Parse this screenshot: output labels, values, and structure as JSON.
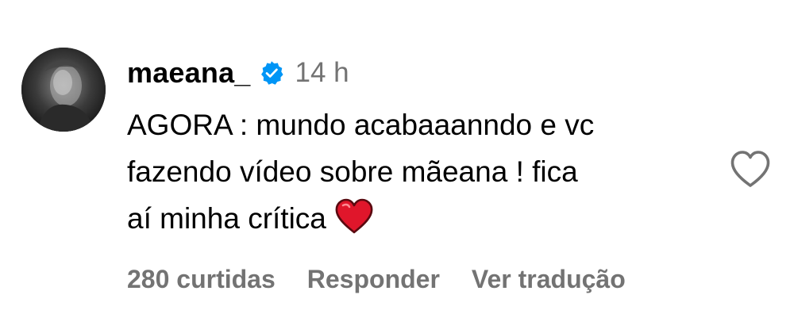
{
  "comment": {
    "username": "maeana_",
    "verified": true,
    "time": "14 h",
    "text": "AGORA : mundo acabaaanndo e vc\nfazendo vídeo sobre mãeana ! fica\naí minha crítica",
    "emoji": "red-heart",
    "likes_label": "280 curtidas",
    "reply_label": "Responder",
    "translate_label": "Ver tradução"
  },
  "colors": {
    "text": "#000000",
    "secondary": "#737373",
    "verified_badge": "#0095f6",
    "heart_emoji": "#e0162b"
  },
  "icons": {
    "verified": "verified-badge-icon",
    "like": "heart-outline-icon",
    "emoji": "red-heart-emoji-icon"
  }
}
